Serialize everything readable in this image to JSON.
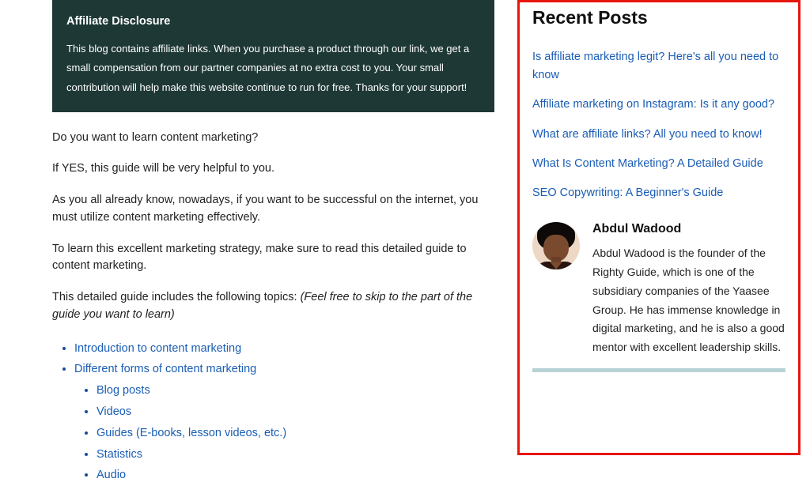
{
  "disclosure": {
    "title": "Affiliate Disclosure",
    "body": "This blog contains affiliate links. When you purchase a product through our link, we get a small compensation from our partner companies at no extra cost to you. Your small contribution will help make this website continue to run for free. Thanks for your support!"
  },
  "content": {
    "p1": "Do you want to learn content marketing?",
    "p2": "If YES, this guide will be very helpful to you.",
    "p3": "As you all already know, nowadays, if you want to be successful on the internet, you must utilize content marketing effectively.",
    "p4": "To learn this excellent marketing strategy, make sure to read this detailed guide to content marketing.",
    "p5a": "This detailed guide includes the following topics: ",
    "p5b": "(Feel free to skip to the part of the guide you want to learn)"
  },
  "toc": {
    "item1": "Introduction to content marketing",
    "item2": "Different forms of content marketing",
    "sub1": "Blog posts",
    "sub2": "Videos",
    "sub3": "Guides (E-books, lesson videos, etc.)",
    "sub4": "Statistics",
    "sub5": "Audio"
  },
  "sidebar": {
    "heading": "Recent Posts",
    "posts": {
      "p1": "Is affiliate marketing legit? Here's all you need to know",
      "p2": "Affiliate marketing on Instagram: Is it any good?",
      "p3": "What are affiliate links? All you need to know!",
      "p4": "What Is Content Marketing? A Detailed Guide",
      "p5": "SEO Copywriting: A Beginner's Guide"
    },
    "author": {
      "name": "Abdul Wadood",
      "bio": "Abdul Wadood is the founder of the Righty Guide, which is one of the subsidiary companies of the Yaasee Group. He has immense knowledge in digital marketing, and he is also a good mentor with excellent leadership skills."
    }
  }
}
